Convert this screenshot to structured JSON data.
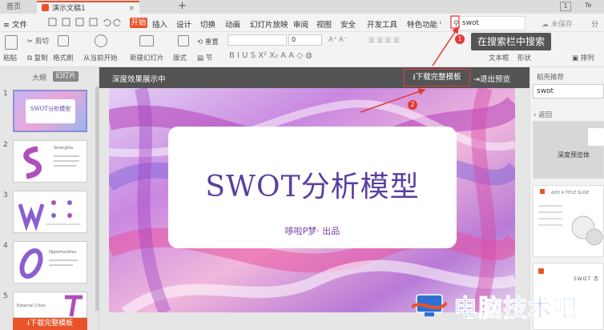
{
  "tabs": {
    "home": "首页",
    "document": "演示文稿1",
    "close": "×",
    "new": "+"
  },
  "window": {
    "page_indicator": "1",
    "user": "Te"
  },
  "menu": {
    "file": "≡ 文件",
    "items": [
      "开始",
      "插入",
      "设计",
      "切换",
      "动画",
      "幻灯片放映",
      "审阅",
      "视图",
      "安全",
      "开发工具",
      "特色功能"
    ],
    "search_value": "swot",
    "unsaved": "未保存",
    "share": "分"
  },
  "toolbar": {
    "paste": "粘贴",
    "cut": "剪切",
    "copy": "复制",
    "format_painter": "格式刷",
    "from_current": "从当前开始",
    "new_slide": "新建幻灯片",
    "layout": "版式",
    "section": "节",
    "reset": "重置",
    "font_size": "0",
    "text_box": "文本框",
    "shape": "形状",
    "arrange": "排列"
  },
  "annotations": {
    "search_tip": "在搜索栏中搜索",
    "step1": "1",
    "step2": "2"
  },
  "left_panel": {
    "outline_tab": "大纲",
    "slides_tab": "幻灯片",
    "numbers": [
      "1",
      "2",
      "3",
      "4",
      "5"
    ],
    "thumb1_title": "SWOT分析模型",
    "thumb2_title": "Strengths",
    "thumb4_title": "Opportunities",
    "thumb5_title": "External Crisis",
    "download_label": "⭳下载完整模板"
  },
  "preview": {
    "header_title": "深度效果展示中",
    "download_button": "⭳下载完整模板",
    "exit_button": "⇥退出预览"
  },
  "slide": {
    "title": "SWOT分析模型",
    "subtitle": "哆啦P梦· 出品"
  },
  "right_panel": {
    "title": "稻壳推荐",
    "search_value": "swot",
    "back": "‹ 返回",
    "card1_label": "深度预览体",
    "card2_label": "ADD A TITLE SLIDE",
    "card3_label": "SWOT 恋"
  },
  "watermark": {
    "text": "电脑技术吧"
  },
  "colors": {
    "accent": "#e8532a",
    "highlight": "#e53935",
    "slide_title": "#5b3fa0",
    "watermark": "#2f6fd6"
  }
}
